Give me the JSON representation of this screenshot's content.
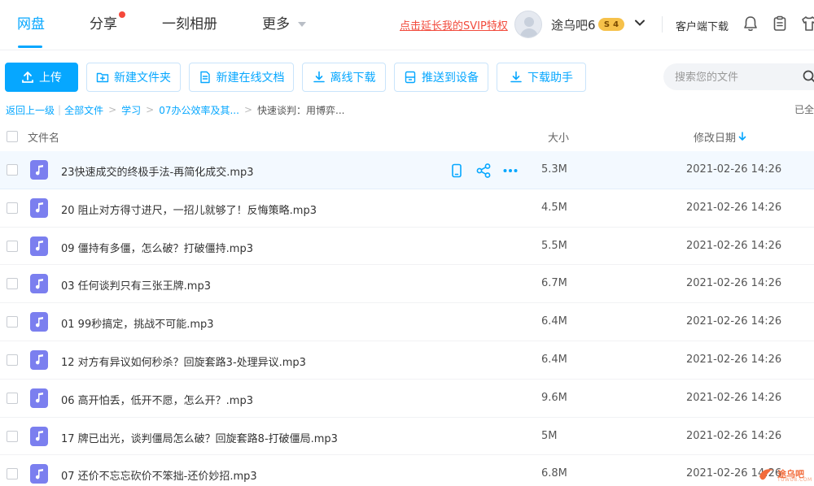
{
  "nav": {
    "tabs": [
      {
        "label": "网盘",
        "active": true
      },
      {
        "label": "分享",
        "active": false
      },
      {
        "label": "一刻相册",
        "active": false
      },
      {
        "label": "更多",
        "active": false
      }
    ],
    "svip_link": "点击延长我的SVIP特权",
    "username": "途乌吧6",
    "vip_badge": {
      "tier": "S",
      "level": "4"
    },
    "client_download": "客户端下载",
    "icons": [
      "bell-icon",
      "clipboard-icon",
      "shirt-icon"
    ]
  },
  "toolbar": {
    "upload": "上传",
    "new_folder": "新建文件夹",
    "new_doc": "新建在线文档",
    "offline_download": "离线下载",
    "push_device": "推送到设备",
    "download_helper": "下载助手"
  },
  "search": {
    "placeholder": "搜索您的文件",
    "value": ""
  },
  "breadcrumb": {
    "back": "返回上一级",
    "items": [
      "全部文件",
      "学习",
      "07办公效率及其..."
    ],
    "current": "快速谈判：用博弈...",
    "loaded_text": "已全"
  },
  "table": {
    "columns": {
      "name": "文件名",
      "size": "大小",
      "modified": "修改日期"
    },
    "sort": {
      "column": "modified",
      "direction": "desc"
    },
    "rows": [
      {
        "name": "23快速成交的终极手法-再简化成交.mp3",
        "size": "5.3M",
        "modified": "2021-02-26 14:26"
      },
      {
        "name": "20 阻止对方得寸进尺，一招儿就够了！反悔策略.mp3",
        "size": "4.5M",
        "modified": "2021-02-26 14:26"
      },
      {
        "name": "09 僵持有多僵，怎么破？打破僵持.mp3",
        "size": "5.5M",
        "modified": "2021-02-26 14:26"
      },
      {
        "name": "03 任何谈判只有三张王牌.mp3",
        "size": "6.7M",
        "modified": "2021-02-26 14:26"
      },
      {
        "name": "01 99秒搞定，挑战不可能.mp3",
        "size": "6.4M",
        "modified": "2021-02-26 14:26"
      },
      {
        "name": "12 对方有异议如何秒杀？回旋套路3-处理异议.mp3",
        "size": "6.4M",
        "modified": "2021-02-26 14:26"
      },
      {
        "name": "06 高开怕丢，低开不愿，怎么开？.mp3",
        "size": "9.6M",
        "modified": "2021-02-26 14:26"
      },
      {
        "name": "17 牌已出光，谈判僵局怎么破？回旋套路8-打破僵局.mp3",
        "size": "5M",
        "modified": "2021-02-26 14:26"
      },
      {
        "name": "07 还价不忘忘砍价不笨拙-还价妙招.mp3",
        "size": "6.8M",
        "modified": "2021-02-26 14:26"
      }
    ],
    "hover_actions": [
      "phone-icon",
      "share-icon",
      "more-icon"
    ]
  },
  "watermark": {
    "text": "途乌吧",
    "sub": "TUWU8.COM"
  },
  "colors": {
    "accent": "#06a7ff",
    "svip_red": "#f24b3d",
    "audio_icon": "#7b7fef"
  }
}
